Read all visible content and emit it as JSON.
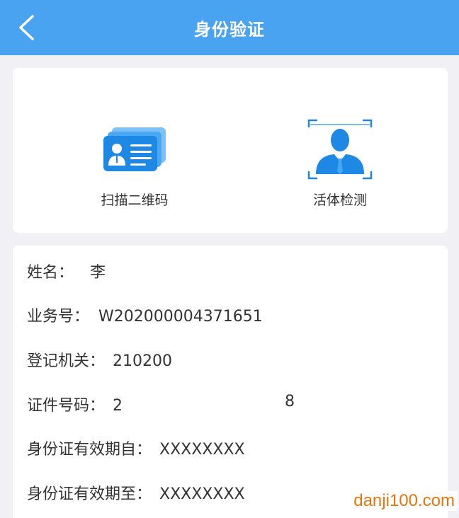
{
  "header": {
    "title": "身份验证"
  },
  "actions": {
    "scan_label": "扫描二维码",
    "liveness_label": "活体检测"
  },
  "info": {
    "name": {
      "label": "姓名：",
      "value": "李"
    },
    "business_no": {
      "label": "业务号：",
      "value": "W202000004371651"
    },
    "registration_office": {
      "label": "登记机关：",
      "value": "210200"
    },
    "id_number": {
      "label": "证件号码：",
      "value_start": "2",
      "value_end": "8"
    },
    "valid_from": {
      "label": "身份证有效期自：",
      "value": "XXXXXXXX"
    },
    "valid_to": {
      "label": "身份证有效期至：",
      "value": "XXXXXXXX"
    }
  },
  "watermark": "danji100.com",
  "colors": {
    "header_bg": "#4aa3f0",
    "icon_blue": "#1e88e5",
    "page_bg": "#f0f0f5",
    "watermark": "#e8740c"
  }
}
